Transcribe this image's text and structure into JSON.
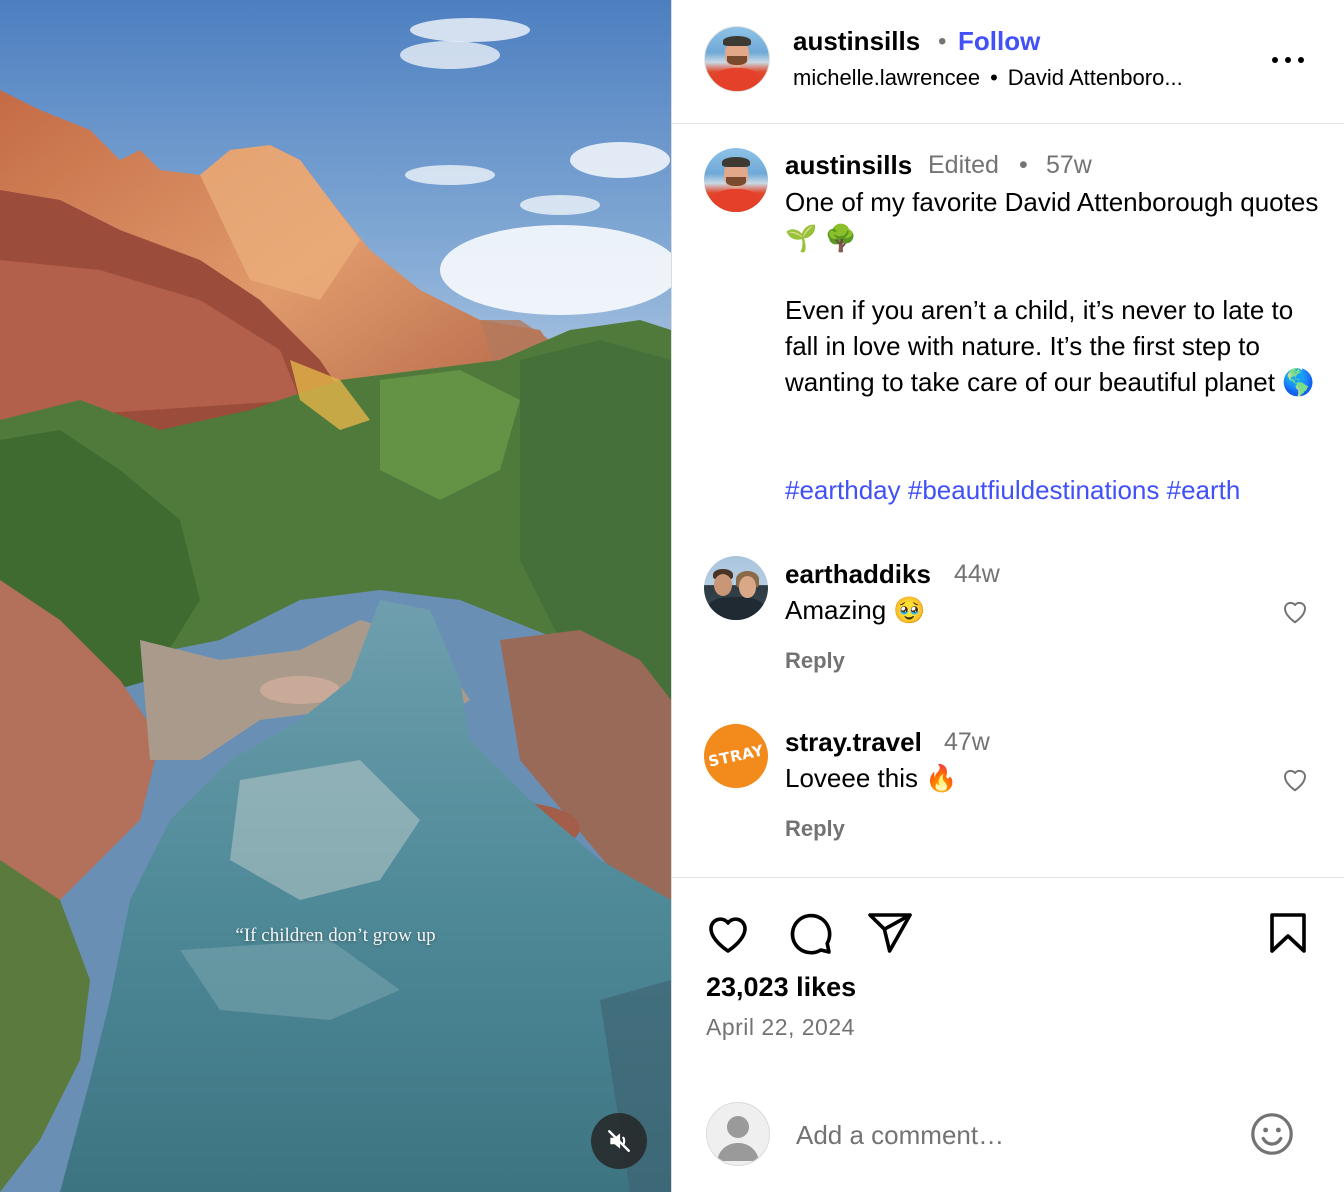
{
  "media": {
    "overlay_text": "“If children don’t grow up",
    "mute_icon": "speaker-muted-icon"
  },
  "header": {
    "username": "austinsills",
    "separator": "•",
    "follow_label": "Follow",
    "audio_user": "michelle.lawrencee",
    "audio_separator": "•",
    "audio_track": "David Attenboro...",
    "more_icon": "more-horizontal-icon"
  },
  "caption": {
    "username": "austinsills",
    "edited_label": "Edited",
    "separator": "•",
    "time": "57w",
    "text": "One of my favorite David Attenborough quotes 🌱 🌳\n\nEven if you aren’t a child, it’s never to late to fall in love with nature. It’s the first step to wanting to take care of our beautiful planet 🌎",
    "hashtags": "#earthday #beautfiuldestinations #earth"
  },
  "comments": [
    {
      "username": "earthaddiks",
      "time": "44w",
      "text": "Amazing 🥹",
      "reply_label": "Reply"
    },
    {
      "username": "stray.travel",
      "time": "47w",
      "text": "Loveee this 🔥",
      "reply_label": "Reply",
      "avatar_text": "STRAY"
    }
  ],
  "actions": {
    "likes": "23,023 likes",
    "date": "April 22, 2024",
    "icons": [
      "heart-icon",
      "comment-icon",
      "share-icon",
      "bookmark-icon"
    ]
  },
  "add_comment": {
    "placeholder": "Add a comment…",
    "emoji_icon": "smiley-icon"
  },
  "colors": {
    "link_blue": "#4150f7",
    "muted_text": "#737373",
    "divider": "#e3e3e3"
  }
}
